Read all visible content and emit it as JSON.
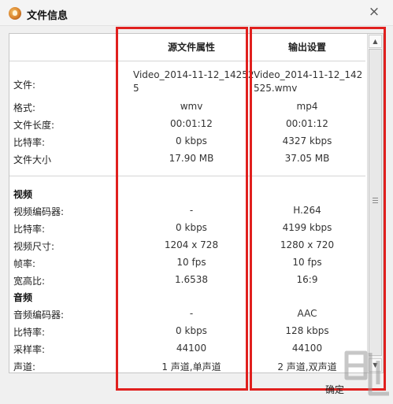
{
  "window": {
    "title": "文件信息",
    "close_glyph": "×"
  },
  "columns": {
    "source": "源文件属性",
    "output": "输出设置"
  },
  "file": {
    "label": "文件:",
    "source": "Video_2014-11-12_142525",
    "output": "Video_2014-11-12_142525.wmv"
  },
  "general_rows": [
    {
      "label": "格式:",
      "source": "wmv",
      "output": "mp4"
    },
    {
      "label": "文件长度:",
      "source": "00:01:12",
      "output": "00:01:12"
    },
    {
      "label": "比特率:",
      "source": "0 kbps",
      "output": "4327 kbps"
    },
    {
      "label": "文件大小",
      "source": "17.90 MB",
      "output": "37.05 MB"
    }
  ],
  "video": {
    "heading": "视频",
    "rows": [
      {
        "label": "视频编码器:",
        "source": "-",
        "output": "H.264"
      },
      {
        "label": "比特率:",
        "source": "0 kbps",
        "output": "4199 kbps"
      },
      {
        "label": "视频尺寸:",
        "source": "1204 x 728",
        "output": "1280 x 720"
      },
      {
        "label": "帧率:",
        "source": "10 fps",
        "output": "10 fps"
      },
      {
        "label": "宽高比:",
        "source": "1.6538",
        "output": "16:9"
      }
    ]
  },
  "audio": {
    "heading": "音频",
    "rows": [
      {
        "label": "音频编码器:",
        "source": "-",
        "output": "AAC"
      },
      {
        "label": "比特率:",
        "source": "0 kbps",
        "output": "128 kbps"
      },
      {
        "label": "采样率:",
        "source": "44100",
        "output": "44100"
      },
      {
        "label": "声道:",
        "source": "1 声道,单声道",
        "output": "2 声道,双声道"
      }
    ]
  },
  "footer": {
    "ok_label": "确定"
  },
  "colors": {
    "highlight": "#e0201e",
    "background": "#f0f0f0"
  },
  "icons": {
    "app": "app-logo-icon",
    "close": "close-icon"
  }
}
